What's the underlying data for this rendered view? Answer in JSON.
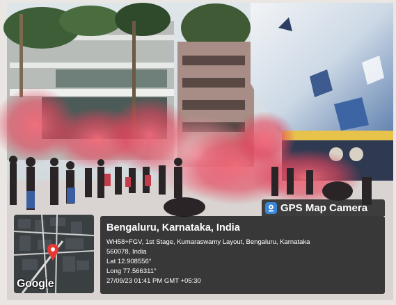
{
  "overlay": {
    "app_badge": "GPS Map Camera",
    "location_title": "Bengaluru, Karnataka, India",
    "address_line1": "WH58+FGV, 1st Stage, Kumaraswamy Layout, Bengaluru, Karnataka",
    "address_line2": "560078, India",
    "latitude": "Lat 12.908556°",
    "longitude": "Long 77.566311°",
    "timestamp": "27/09/23 01:41 PM GMT +05:30"
  },
  "map": {
    "provider_logo": "Google",
    "marker_icon": "location-pin-icon"
  },
  "colors": {
    "smoke": "#e2455b",
    "panel": "#161616",
    "badge_icon": "#3b86d6"
  }
}
